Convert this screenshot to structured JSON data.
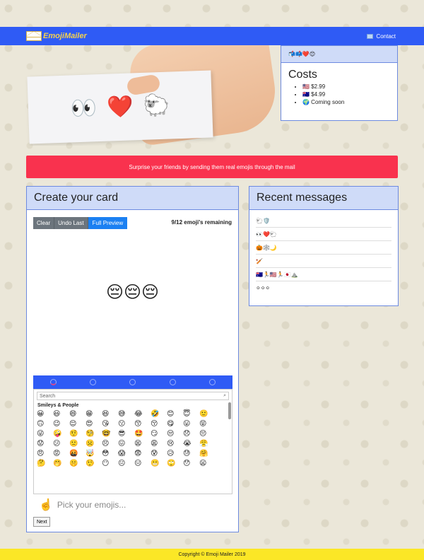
{
  "navbar": {
    "brand": "EmojiMailer",
    "contact": "Contact"
  },
  "hero": {
    "card_emojis": [
      "👀",
      "❤️",
      "🐑"
    ]
  },
  "costs": {
    "top_emojis": "📬📫❤️😊",
    "title": "Costs",
    "items": [
      "🇺🇸 $2.99",
      "🇦🇺 $4.99",
      "🌍 Coming soon"
    ]
  },
  "banner": {
    "text": "Surprise your friends by sending them real emojis through the mail"
  },
  "create": {
    "title": "Create your card",
    "buttons": {
      "clear": "Clear",
      "undo": "Undo Last",
      "preview": "Full Preview"
    },
    "remaining": "9/12 emoji's remaining",
    "preview_emojis": "😔😔😔",
    "picker": {
      "search_placeholder": "Search",
      "category": "Smileys & People",
      "emojis": [
        "😀",
        "😃",
        "😄",
        "😁",
        "😆",
        "😅",
        "😂",
        "🤣",
        "😊",
        "😇",
        "🙂",
        "🙃",
        "😉",
        "😌",
        "😍",
        "😘",
        "😗",
        "😙",
        "😚",
        "😋",
        "😛",
        "😝",
        "😜",
        "🤪",
        "🤨",
        "🧐",
        "🤓",
        "😎",
        "🤩",
        "😏",
        "😒",
        "😞",
        "😔",
        "😟",
        "😕",
        "🙁",
        "☹️",
        "😣",
        "😖",
        "😫",
        "😩",
        "😢",
        "😭",
        "😤",
        "😠",
        "😡",
        "🤬",
        "🤯",
        "😳",
        "😱",
        "😨",
        "😰",
        "😥",
        "😓",
        "🤗",
        "🤔",
        "🤭",
        "🤫",
        "🤥",
        "😶",
        "😐",
        "😑",
        "😬",
        "🙄",
        "😯",
        "😦"
      ]
    },
    "pick_label": "Pick your emojis...",
    "next": "Next"
  },
  "recent": {
    "title": "Recent messages",
    "messages": [
      "🐑🛡️",
      "👀❤️🐑",
      "🎃🕸️🌙",
      "🏏",
      "🇦🇺🏃🇺🇸🏃🇯🇵⛰️",
      "⚪⚪⚪"
    ]
  },
  "footer": {
    "text": "Copyright © Emoji Mailer 2019"
  }
}
